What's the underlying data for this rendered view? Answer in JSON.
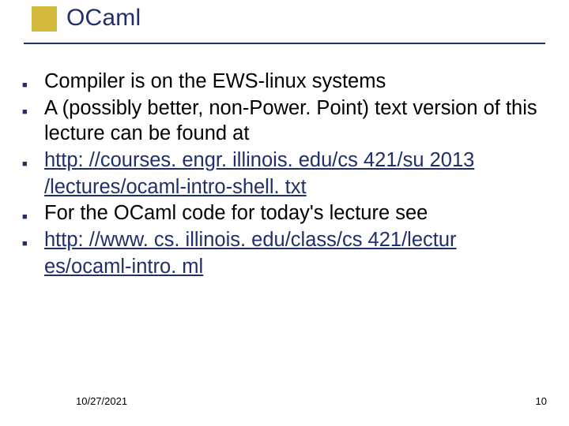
{
  "title": "OCaml",
  "bullets": {
    "b1": "Compiler is on the EWS-linux systems",
    "b2": "A (possibly better, non-Power. Point) text version of this lecture can be found at",
    "b3a": "http: //courses. engr. illinois. edu/cs 421/su 2013",
    "b3b": "/lectures/ocaml-intro-shell. txt",
    "b4": "For the OCaml code for today's lecture see",
    "b5a": "http: //www. cs. illinois. edu/class/cs 421/lectur",
    "b5b": "es/ocaml-intro. ml"
  },
  "footer": {
    "date": "10/27/2021",
    "page": "10"
  },
  "bullet_glyph": "■"
}
